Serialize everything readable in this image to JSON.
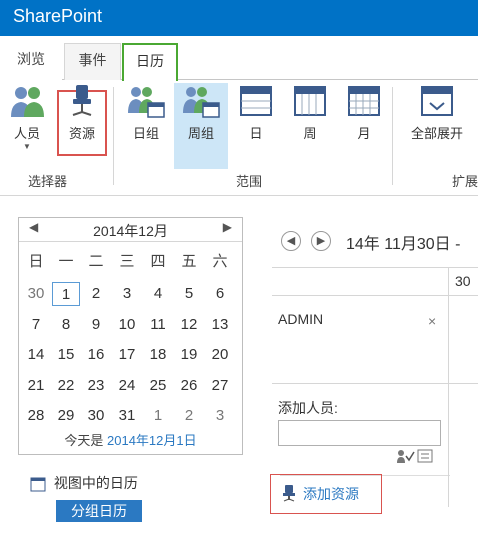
{
  "app": {
    "brand": "SharePoint"
  },
  "tabs": [
    {
      "label": "浏览"
    },
    {
      "label": "事件"
    },
    {
      "label": "日历"
    }
  ],
  "ribbon": {
    "selector": {
      "people": "人员",
      "resources": "资源",
      "group_label": "选择器"
    },
    "scope": {
      "day_group": "日组",
      "week_group": "周组",
      "day": "日",
      "week": "周",
      "month": "月",
      "group_label": "范围"
    },
    "expand": {
      "expand_all": "全部展开",
      "group_label": "扩展"
    }
  },
  "mini_calendar": {
    "title": "2014年12月",
    "weekdays": [
      "日",
      "一",
      "二",
      "三",
      "四",
      "五",
      "六"
    ],
    "weeks": [
      [
        "30",
        "1",
        "2",
        "3",
        "4",
        "5",
        "6"
      ],
      [
        "7",
        "8",
        "9",
        "10",
        "11",
        "12",
        "13"
      ],
      [
        "14",
        "15",
        "16",
        "17",
        "18",
        "19",
        "20"
      ],
      [
        "21",
        "22",
        "23",
        "24",
        "25",
        "26",
        "27"
      ],
      [
        "28",
        "29",
        "30",
        "31",
        "1",
        "2",
        "3"
      ]
    ],
    "today_prefix": "今天是",
    "today_link": "2014年12月1日"
  },
  "calendars_in_view": {
    "label": "视图中的日历",
    "group_calendar": "分组日历"
  },
  "main": {
    "date_range": "14年 11月30日 -",
    "column_header": "30",
    "member": "ADMIN",
    "remove_symbol": "×",
    "add_person_label": "添加人员:",
    "add_resource": "添加资源"
  }
}
